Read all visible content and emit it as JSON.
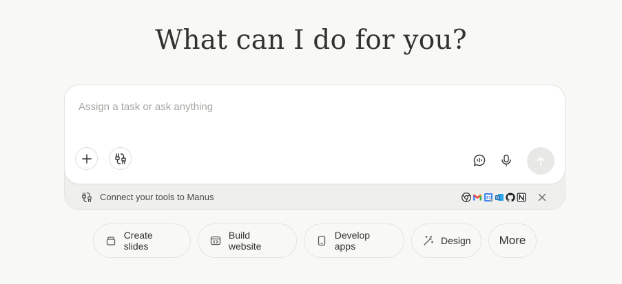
{
  "headline": "What can I do for you?",
  "composer": {
    "placeholder": "Assign a task or ask anything",
    "value": ""
  },
  "connect_bar": {
    "label": "Connect your tools to Manus",
    "tool_icons": [
      "chrome-icon",
      "gmail-icon",
      "google-calendar-icon",
      "outlook-icon",
      "github-icon",
      "notion-icon"
    ]
  },
  "chips": [
    {
      "label": "Create slides",
      "icon": "slides-icon"
    },
    {
      "label": "Build website",
      "icon": "website-icon"
    },
    {
      "label": "Develop apps",
      "icon": "phone-icon"
    },
    {
      "label": "Design",
      "icon": "magic-wand-icon"
    },
    {
      "label": "More",
      "icon": ""
    }
  ],
  "colors": {
    "background": "#f8f8f7",
    "text": "#34322d",
    "placeholder": "#a5a4a0",
    "border": "#e2e2df"
  }
}
